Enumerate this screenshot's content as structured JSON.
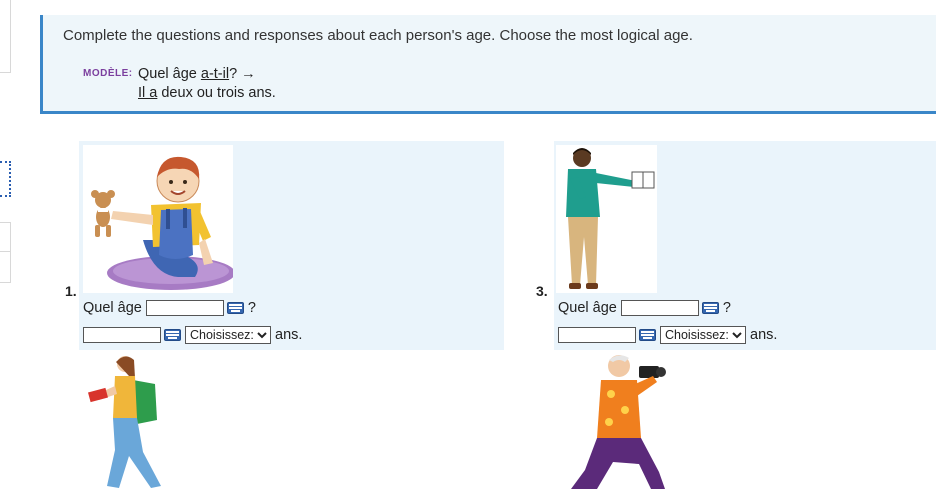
{
  "instructions": {
    "text": "Complete the questions and responses about each person's age. Choose the most logical age.",
    "modele_label": "MODÈLE:",
    "modele_question_prefix": "Quel âge ",
    "modele_question_verb": "a-t-il",
    "modele_question_suffix": "? →",
    "modele_answer_subject": "Il a",
    "modele_answer_rest": " deux ou trois ans."
  },
  "items": [
    {
      "number": "1.",
      "question_prefix": "Quel âge",
      "question_mark": "?",
      "select_value": "Choisissez:",
      "answer_suffix": "ans.",
      "picture_icon": "toddler-with-teddy-bear"
    },
    {
      "number": "3.",
      "question_prefix": "Quel âge",
      "question_mark": "?",
      "select_value": "Choisissez:",
      "answer_suffix": "ans.",
      "picture_icon": "man-holding-book"
    }
  ],
  "next_pictures": [
    {
      "picture_icon": "student-with-backpack"
    },
    {
      "picture_icon": "elderly-photographer"
    }
  ],
  "colors": {
    "panel_bg": "#eef6fa",
    "accent_border": "#3a86c8",
    "modele_label": "#7b3f9e",
    "item_bg": "#eaf4fb"
  }
}
